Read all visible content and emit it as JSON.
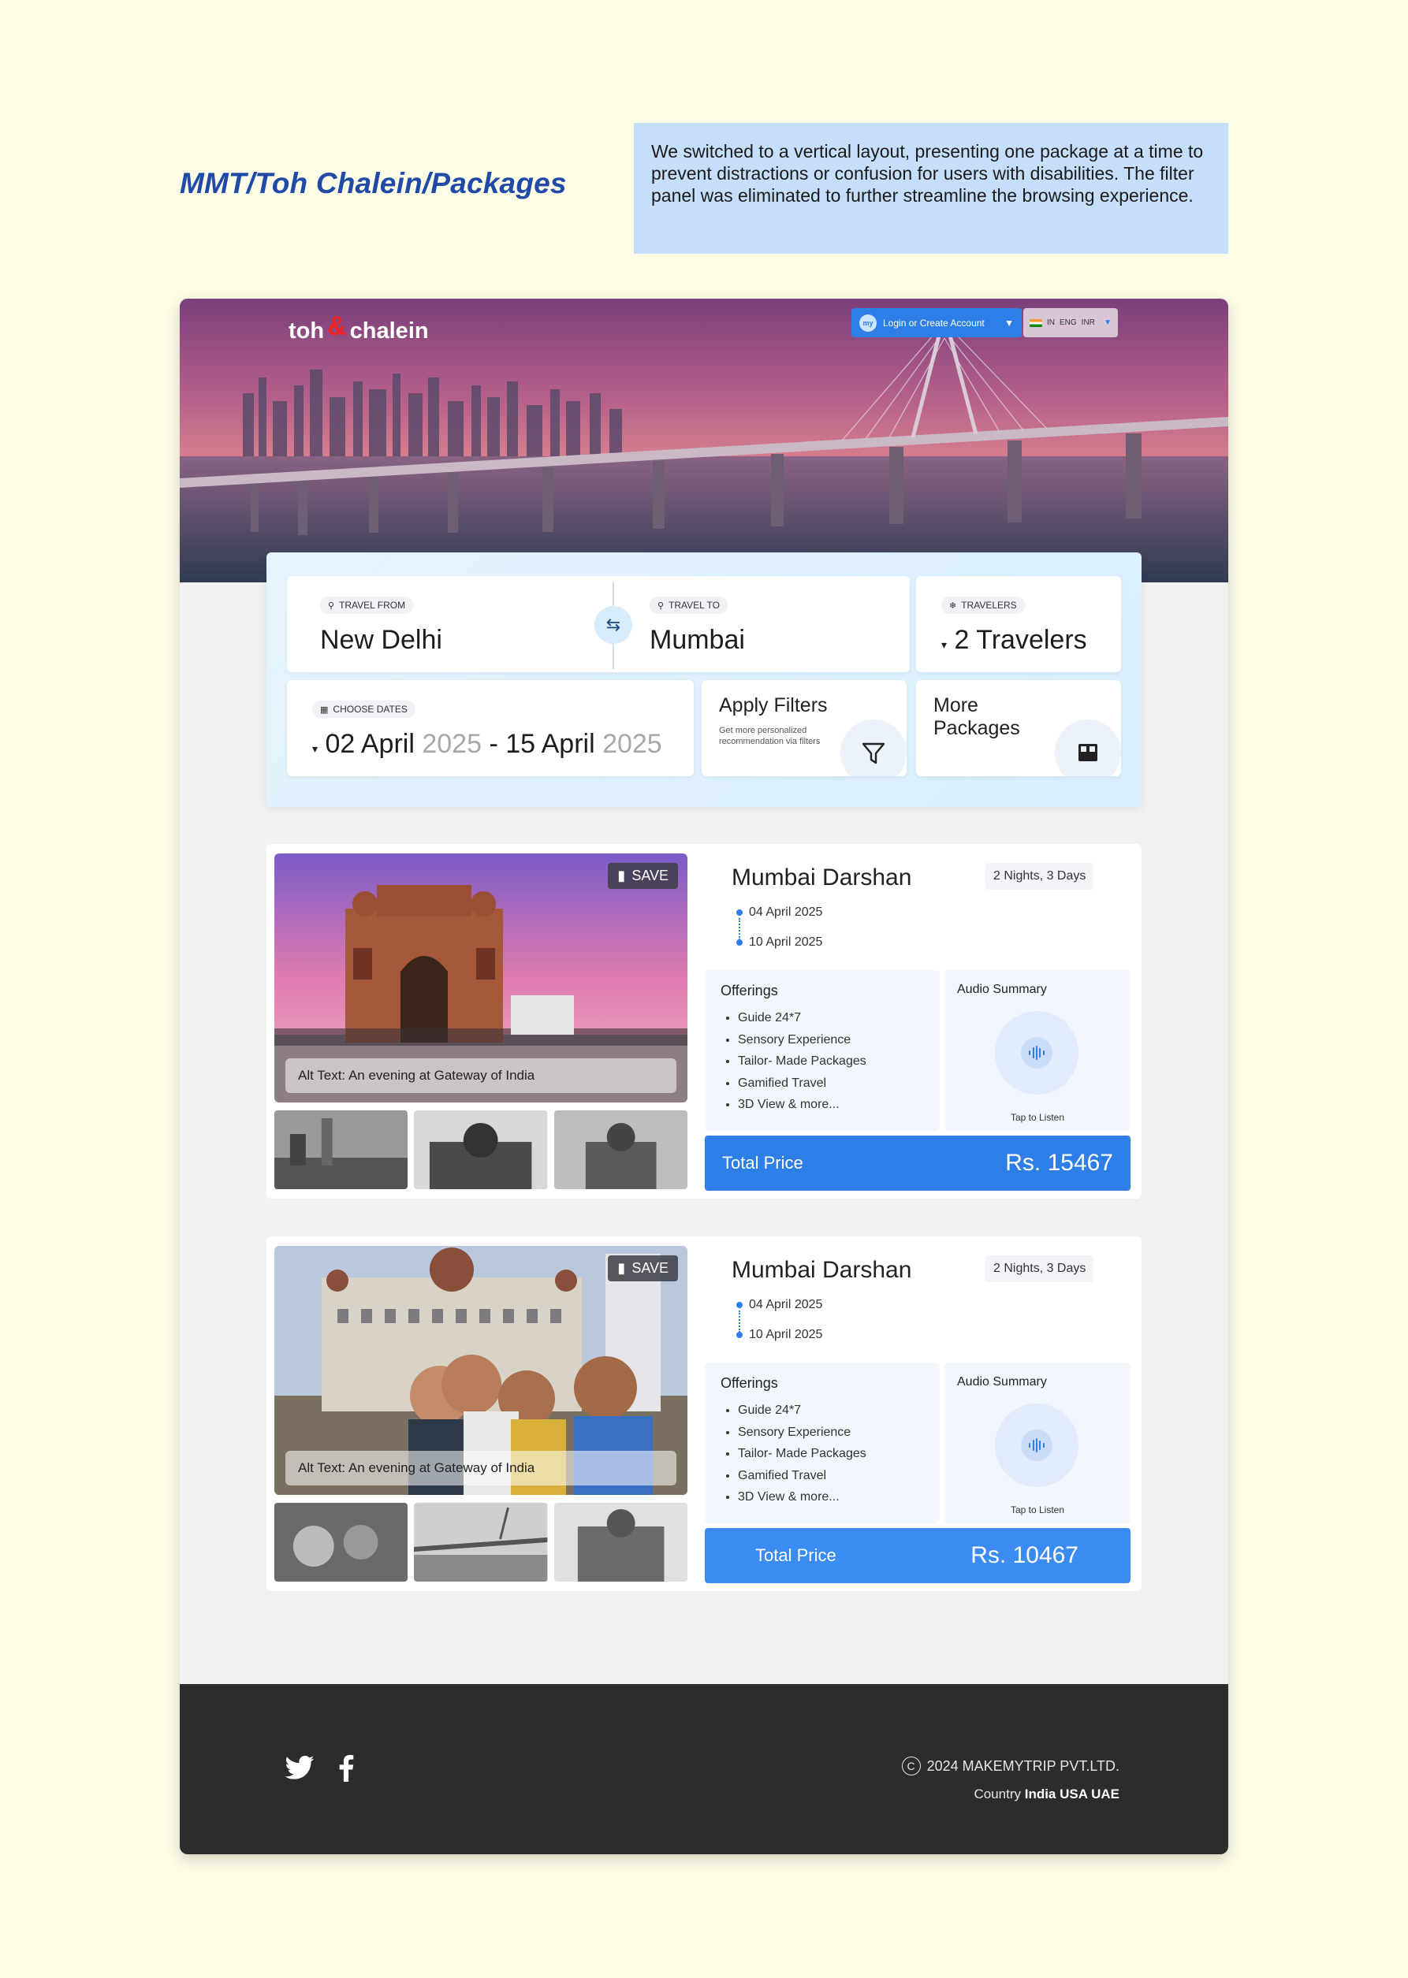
{
  "heading": "MMT/Toh Chalein/Packages",
  "note": "We switched to a vertical layout, presenting one package at a time to prevent distractions or confusion for users with disabilities. The filter panel was eliminated to further streamline the browsing experience.",
  "header": {
    "brand_left": "toh",
    "brand_right": "chalein",
    "login_label": "Login or Create Account",
    "locale": {
      "country": "IN",
      "language": "ENG",
      "currency": "INR"
    }
  },
  "search": {
    "from_label": "TRAVEL FROM",
    "from_value": "New Delhi",
    "to_label": "TRAVEL TO",
    "to_value": "Mumbai",
    "travelers_label": "TRAVELERS",
    "travelers_value": "2 Travelers",
    "dates_label": "CHOOSE DATES",
    "date_start_day": "02 April",
    "date_start_year": "2025",
    "date_sep": "-",
    "date_end_day": "15 April",
    "date_end_year": "2025",
    "filters_title": "Apply Filters",
    "filters_sub": "Get more personalized recommendation via filters",
    "more_title": "More Packages"
  },
  "packages": [
    {
      "save_label": "SAVE",
      "alt_text": "Alt Text: An evening at Gateway of India",
      "title": "Mumbai Darshan",
      "duration": "2 Nights, 3 Days",
      "start_date": "04 April 2025",
      "end_date": "10 April 2025",
      "offerings_title": "Offerings",
      "offerings": [
        "Guide 24*7",
        "Sensory Experience",
        "Tailor- Made Packages",
        "Gamified Travel",
        "3D View & more..."
      ],
      "audio_title": "Audio Summary",
      "audio_cta": "Tap to Listen",
      "total_label": "Total Price",
      "total_price": "Rs. 15467",
      "bar_color": "#2D7EE7"
    },
    {
      "save_label": "SAVE",
      "alt_text": "Alt Text: An evening at Gateway of India",
      "title": "Mumbai Darshan",
      "duration": "2 Nights, 3 Days",
      "start_date": "04 April 2025",
      "end_date": "10 April 2025",
      "offerings_title": "Offerings",
      "offerings": [
        "Guide 24*7",
        "Sensory Experience",
        "Tailor- Made Packages",
        "Gamified Travel",
        "3D View & more..."
      ],
      "audio_title": "Audio Summary",
      "audio_cta": "Tap to Listen",
      "total_label": "Total Price",
      "total_price": "Rs. 10467",
      "bar_color": "#3A8BF2"
    }
  ],
  "footer": {
    "copyright": "2024 MAKEMYTRIP PVT.LTD.",
    "country_label": "Country",
    "countries": "India USA UAE"
  }
}
